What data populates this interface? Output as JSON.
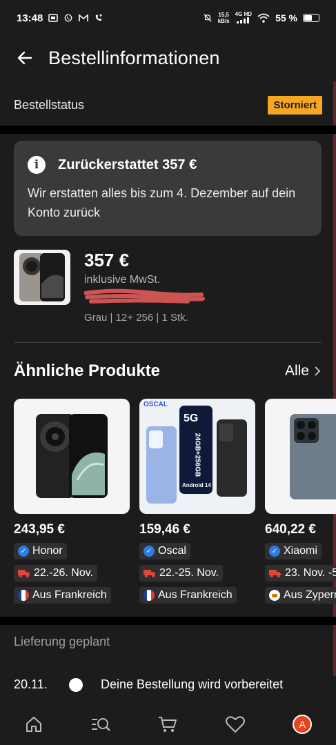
{
  "status_bar": {
    "time": "13:48",
    "net_speed_value": "15,5",
    "net_speed_unit": "kB/s",
    "network": "4G HD",
    "battery": "55 %"
  },
  "header": {
    "title": "Bestellinformationen"
  },
  "order_status": {
    "label": "Bestellstatus",
    "badge": "Storniert",
    "badge_color": "#f5a623"
  },
  "refund": {
    "title": "Zurückerstattet 357 €",
    "text": "Wir erstatten alles bis zum 4. Dezember auf dein Konto zurück"
  },
  "product": {
    "price": "357 €",
    "vat": "inklusive MwSt.",
    "variant": "Grau | 12+ 256 | 1 Stk."
  },
  "similar": {
    "heading": "Ähnliche Produkte",
    "all_label": "Alle",
    "items": [
      {
        "price": "243,95 €",
        "brand": "Honor",
        "delivery": "22.-26. Nov.",
        "origin": "Aus Frankreich"
      },
      {
        "price": "159,46 €",
        "brand": "Oscal",
        "delivery": "22.-25. Nov.",
        "origin": "Aus Frankreich",
        "image_text": {
          "logo": "OSCAL",
          "badge": "5G",
          "spec": "24GB+256GB",
          "os": "Android 14"
        }
      },
      {
        "price": "640,22 €",
        "brand": "Xiaomi",
        "delivery": "23. Nov. -5",
        "origin": "Aus Zypern"
      }
    ]
  },
  "delivery": {
    "label": "Lieferung geplant",
    "date": "20.11.",
    "text": "Deine Bestellung wird vorbereitet"
  },
  "bottom_nav": {
    "items": [
      "home-icon",
      "search-list-icon",
      "cart-icon",
      "heart-icon",
      "profile-avatar"
    ],
    "avatar_letter": "A",
    "avatar_color": "#e8451e"
  }
}
